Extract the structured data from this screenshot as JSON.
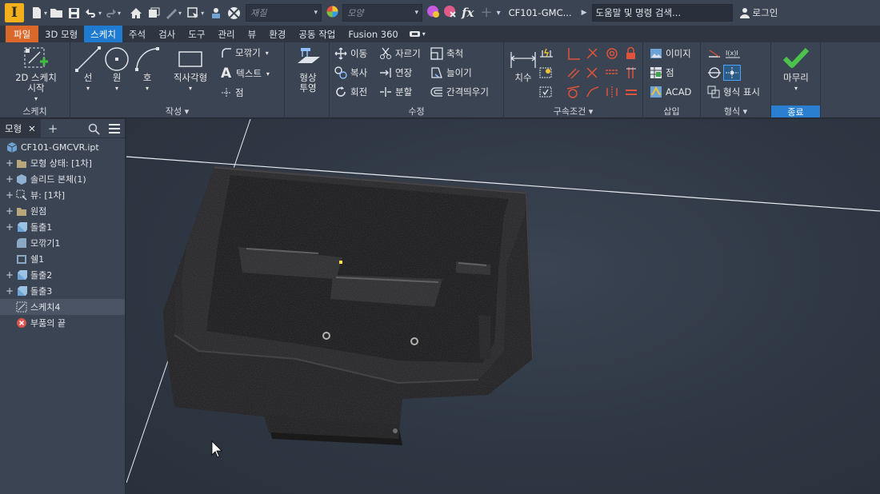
{
  "titlebar": {
    "logo": "I",
    "material_placeholder": "재질",
    "appearance_placeholder": "모양",
    "fx_label": "fx",
    "document_title": "CF101-GMC...",
    "search_label": "도움말 및 명령 검색...",
    "login_label": "로그인"
  },
  "tabs": [
    {
      "label": "파일"
    },
    {
      "label": "3D 모형"
    },
    {
      "label": "스케치"
    },
    {
      "label": "주석"
    },
    {
      "label": "검사"
    },
    {
      "label": "도구"
    },
    {
      "label": "관리"
    },
    {
      "label": "뷰"
    },
    {
      "label": "환경"
    },
    {
      "label": "공동 작업"
    },
    {
      "label": "Fusion 360"
    }
  ],
  "ribbon": {
    "sketch_panel": {
      "title": "스케치",
      "start_2d_line1": "2D 스케치",
      "start_2d_line2": "시작"
    },
    "create_panel": {
      "title": "작성 ▾",
      "line": "선",
      "circle": "원",
      "arc": "호",
      "rectangle": "직사각형",
      "fillet": "모깎기",
      "text": "텍스트",
      "point": "점",
      "project_line1": "형상",
      "project_line2": "투영"
    },
    "modify_panel": {
      "title": "수정",
      "move": "이동",
      "copy": "복사",
      "rotate": "회전",
      "trim": "자르기",
      "extend": "연장",
      "split": "분할",
      "scale": "축척",
      "stretch": "늘이기",
      "offset": "간격띄우기"
    },
    "constrain_panel": {
      "title": "구속조건 ▾",
      "dimension": "치수"
    },
    "insert_panel": {
      "title": "삽입",
      "image": "이미지",
      "point": "점",
      "acad": "ACAD"
    },
    "format_panel": {
      "title": "형식 ▾",
      "show_format": "형식 표시"
    },
    "exit_panel": {
      "title": "종료",
      "finish": "마무리"
    }
  },
  "browser": {
    "tab_label": "모형",
    "close_symbol": "✕",
    "add_symbol": "+",
    "items": [
      {
        "label": "CF101-GMCVR.ipt",
        "expander": "",
        "icon": "part-icon"
      },
      {
        "label": "모형 상태: [1차]",
        "expander": "+",
        "icon": "folder-icon"
      },
      {
        "label": "솔리드 본체(1)",
        "expander": "+",
        "icon": "solid-body-icon"
      },
      {
        "label": "뷰: [1차]",
        "expander": "+",
        "icon": "view-icon"
      },
      {
        "label": "원점",
        "expander": "+",
        "icon": "folder-icon"
      },
      {
        "label": "돌출1",
        "expander": "+",
        "icon": "extrude-icon"
      },
      {
        "label": "모깎기1",
        "expander": "",
        "icon": "fillet-icon"
      },
      {
        "label": "쉘1",
        "expander": "",
        "icon": "shell-icon"
      },
      {
        "label": "돌출2",
        "expander": "+",
        "icon": "extrude-icon"
      },
      {
        "label": "돌출3",
        "expander": "+",
        "icon": "extrude-icon"
      },
      {
        "label": "스케치4",
        "expander": "",
        "icon": "sketch-icon"
      },
      {
        "label": "부품의 끝",
        "expander": "",
        "icon": "end-of-part-icon"
      }
    ]
  },
  "colors": {
    "accent": "#1e7bd0",
    "file_tab": "#d9682a",
    "ribbon_bg": "#3b4453",
    "viewport_bg": "#2f3744",
    "finish_check": "#4bc24b"
  }
}
